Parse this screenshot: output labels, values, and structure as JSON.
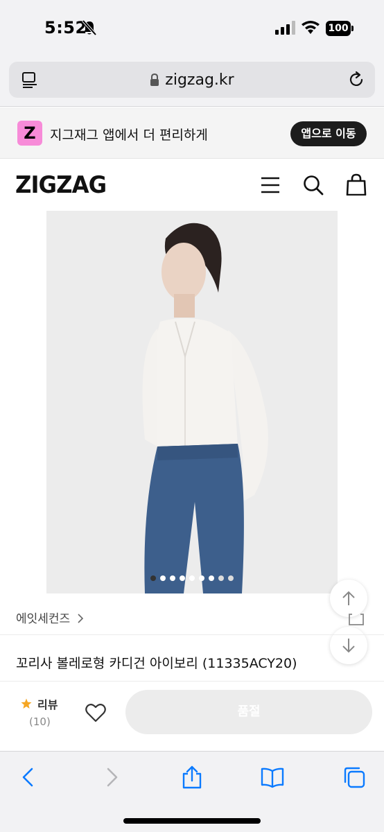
{
  "status_bar": {
    "time": "5:52",
    "battery": "100",
    "icons": [
      "silent-bell-icon",
      "signal-icon",
      "wifi-icon",
      "battery-icon"
    ]
  },
  "address_bar": {
    "url": "zigzag.kr",
    "icons": [
      "reader-icon",
      "lock-icon",
      "reload-icon"
    ]
  },
  "app_banner": {
    "logo_letter": "Z",
    "text": "지그재그 앱에서 더 편리하게",
    "button_label": "앱으로 이동",
    "accent_color": "#f78bd8"
  },
  "site_header": {
    "logo": "ZIGZAG",
    "icons": [
      "menu-icon",
      "search-icon",
      "shopping-bag-icon"
    ]
  },
  "product": {
    "image_count": 9,
    "active_image": 1,
    "brand": "에잇세컨즈",
    "name": "꼬리사 볼레로형 카디건 아이보리 (11335ACY20)"
  },
  "purchase_bar": {
    "review_label": "리뷰",
    "review_count": "(10)",
    "buy_button_label": "품절",
    "star_color": "#f5a623"
  },
  "browser_toolbar": {
    "icons": [
      "back-icon",
      "forward-icon",
      "share-icon",
      "bookmarks-icon",
      "tabs-icon"
    ],
    "accent_color": "#0a7aff"
  }
}
